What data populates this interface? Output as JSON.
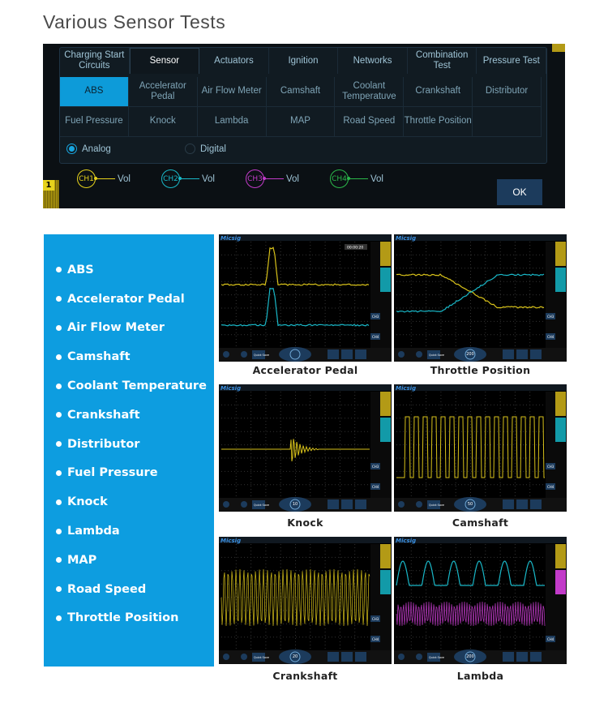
{
  "page_title": "Various Sensor Tests",
  "dialog": {
    "tabs": [
      "Charging Start Circuits",
      "Sensor",
      "Actuators",
      "Ignition",
      "Networks",
      "Combination Test",
      "Pressure Test"
    ],
    "active_tab": "Sensor",
    "sensors": [
      "ABS",
      "Accelerator Pedal",
      "Air Flow Meter",
      "Camshaft",
      "Coolant Temperatuve",
      "Crankshaft",
      "Distributor",
      "Fuel Pressure",
      "Knock",
      "Lambda",
      "MAP",
      "Road Speed",
      "Throttle Position",
      ""
    ],
    "selected_sensor": "ABS",
    "modes": [
      {
        "label": "Analog",
        "selected": true
      },
      {
        "label": "Digital",
        "selected": false
      }
    ],
    "channels": [
      {
        "name": "CH1",
        "unit": "Vol",
        "color": "#e6d21c"
      },
      {
        "name": "CH2",
        "unit": "Vol",
        "color": "#19b8c8"
      },
      {
        "name": "CH3",
        "unit": "Vol",
        "color": "#c23bc9"
      },
      {
        "name": "CH4",
        "unit": "Vol",
        "color": "#2bb84a"
      }
    ],
    "ok_label": "OK",
    "marker": "1"
  },
  "sidebar": {
    "items": [
      "ABS",
      "Accelerator Pedal",
      "Air Flow Meter",
      "Camshaft",
      "Coolant Temperature",
      "Crankshaft",
      "Distributor",
      "Fuel Pressure",
      "Knock",
      "Lambda",
      "MAP",
      "Road Speed",
      "Throttle Position"
    ]
  },
  "scopes": [
    {
      "caption": "Accelerator Pedal",
      "wave": "pulse",
      "knob": "",
      "timer": "00:00:20"
    },
    {
      "caption": "Throttle Position",
      "wave": "cross",
      "knob": "200",
      "timer": ""
    },
    {
      "caption": "Knock",
      "wave": "knock",
      "knob": "10",
      "timer": ""
    },
    {
      "caption": "Camshaft",
      "wave": "square",
      "knob": "50",
      "timer": ""
    },
    {
      "caption": "Crankshaft",
      "wave": "dense",
      "knob": "20",
      "timer": ""
    },
    {
      "caption": "Lambda",
      "wave": "lambda",
      "knob": "200",
      "timer": ""
    }
  ],
  "scope_ui": {
    "brand": "Micsig",
    "quick_save": "Quick Save",
    "ch3": "CH3",
    "ch4": "CH4"
  },
  "colors": {
    "accent": "#0d9de0",
    "ch1": "#e6d21c",
    "ch2": "#19b8c8",
    "ch3": "#c23bc9"
  }
}
